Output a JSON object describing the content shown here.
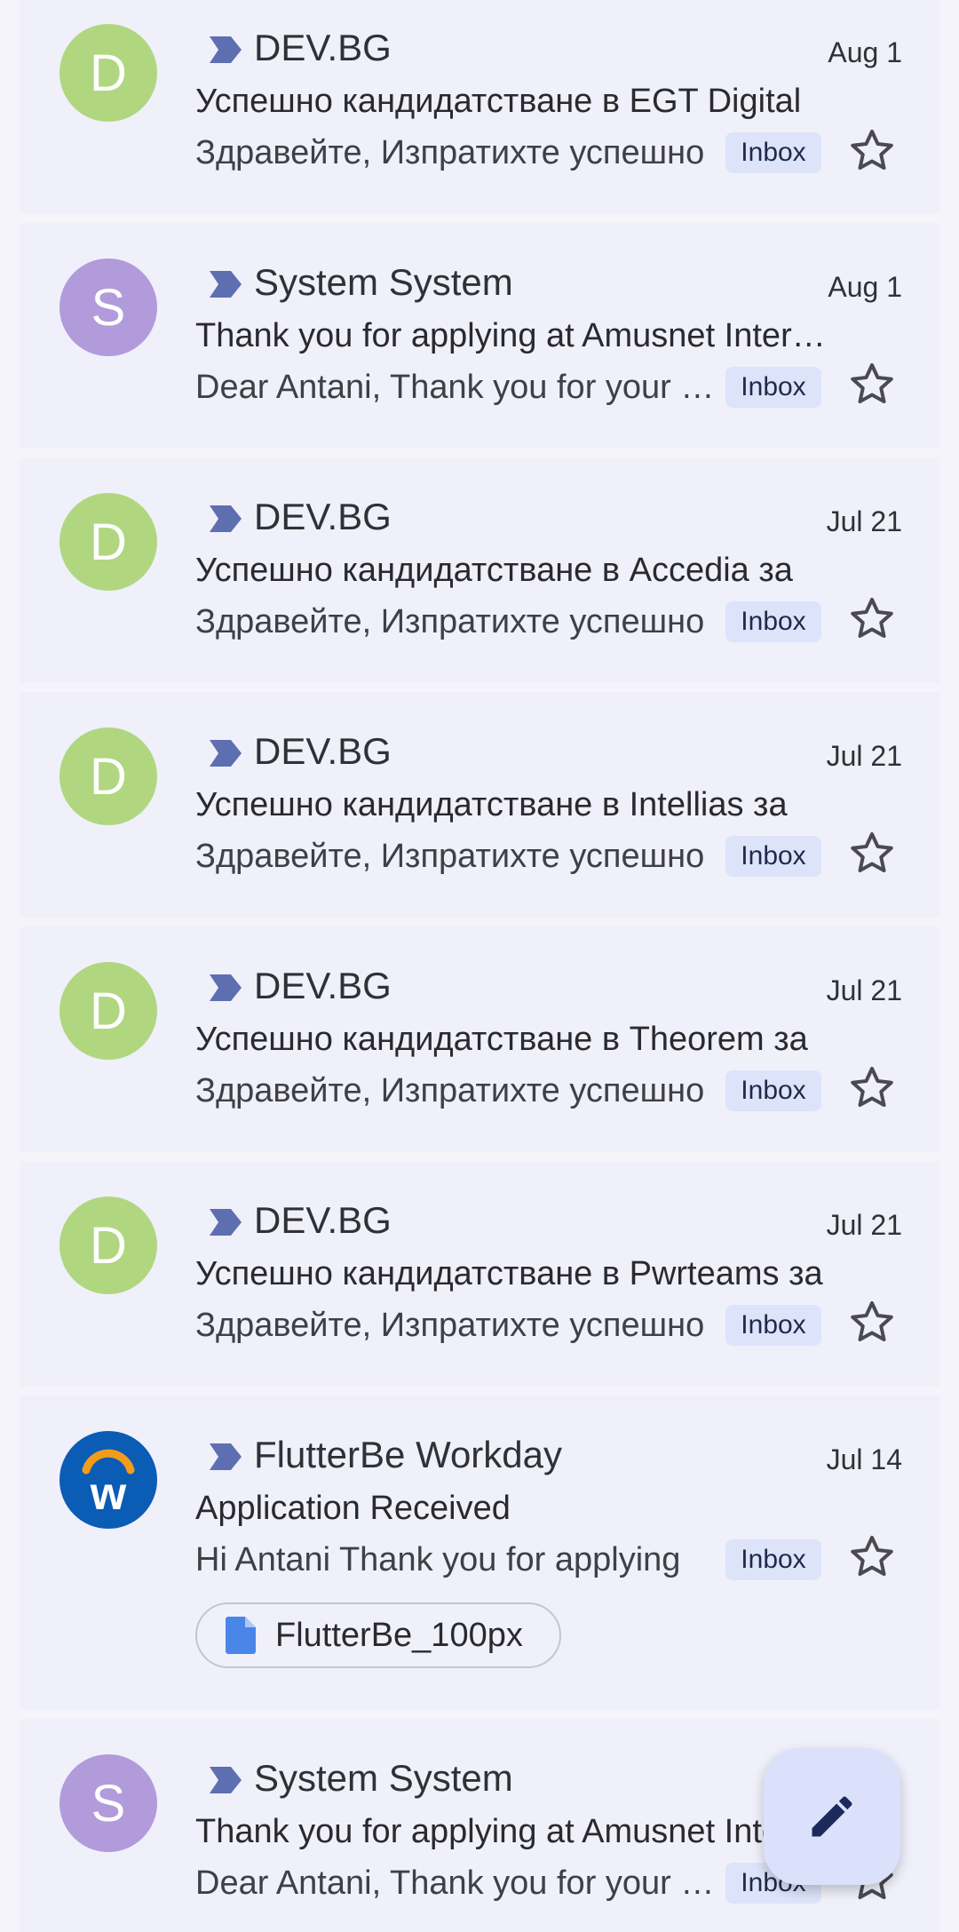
{
  "colors": {
    "background": "#f6f4fb",
    "card": "#f0f0fb",
    "importance": "#5d6fb0",
    "badge_bg": "#dde3f9",
    "avatar_green": "#b0d780",
    "avatar_purple": "#b19bdb",
    "workday_blue": "#0b5cb5",
    "workday_orange": "#f39c1b",
    "fab_bg": "#dbe1fb",
    "fab_icon": "#1b2a5a"
  },
  "emails": [
    {
      "avatar_letter": "D",
      "avatar_color": "#b0d780",
      "sender": "DEV.BG",
      "date": "Aug 1",
      "subject": "Успешно кандидатстване в EGT Digital",
      "snippet": "Здравейте, Изпратихте успешно",
      "label": "Inbox"
    },
    {
      "avatar_letter": "S",
      "avatar_color": "#b19bdb",
      "sender": "System System",
      "date": "Aug 1",
      "subject": "Thank you for applying at Amusnet Interactive",
      "snippet": "Dear Antani, Thank you for your application",
      "label": "Inbox"
    },
    {
      "avatar_letter": "D",
      "avatar_color": "#b0d780",
      "sender": "DEV.BG",
      "date": "Jul 21",
      "subject": "Успешно кандидатстване в Accedia за",
      "snippet": "Здравейте, Изпратихте успешно",
      "label": "Inbox"
    },
    {
      "avatar_letter": "D",
      "avatar_color": "#b0d780",
      "sender": "DEV.BG",
      "date": "Jul 21",
      "subject": "Успешно кандидатстване в Intellias за",
      "snippet": "Здравейте, Изпратихте успешно",
      "label": "Inbox"
    },
    {
      "avatar_letter": "D",
      "avatar_color": "#b0d780",
      "sender": "DEV.BG",
      "date": "Jul 21",
      "subject": "Успешно кандидатстване в Theorem за",
      "snippet": "Здравейте, Изпратихте успешно",
      "label": "Inbox"
    },
    {
      "avatar_letter": "D",
      "avatar_color": "#b0d780",
      "sender": "DEV.BG",
      "date": "Jul 21",
      "subject": "Успешно кандидатстване в Pwrteams за",
      "snippet": "Здравейте, Изпратихте успешно",
      "label": "Inbox"
    },
    {
      "avatar_letter": "w",
      "avatar_type": "workday",
      "sender": "FlutterBe Workday",
      "date": "Jul 14",
      "subject": "Application Received",
      "snippet": "Hi Antani Thank you for applying",
      "label": "Inbox",
      "attachment": "FlutterBe_100px"
    },
    {
      "avatar_letter": "S",
      "avatar_color": "#b19bdb",
      "sender": "System System",
      "date": "",
      "subject": "Thank you for applying at Amusnet Interactive",
      "snippet": "Dear Antani, Thank you for your application",
      "label": "Inbox"
    }
  ],
  "icons": {
    "importance": "importance-marker-icon",
    "star": "star-outline-icon",
    "attachment": "document-file-icon",
    "compose": "pencil-icon"
  },
  "fab": {
    "name": "compose"
  }
}
